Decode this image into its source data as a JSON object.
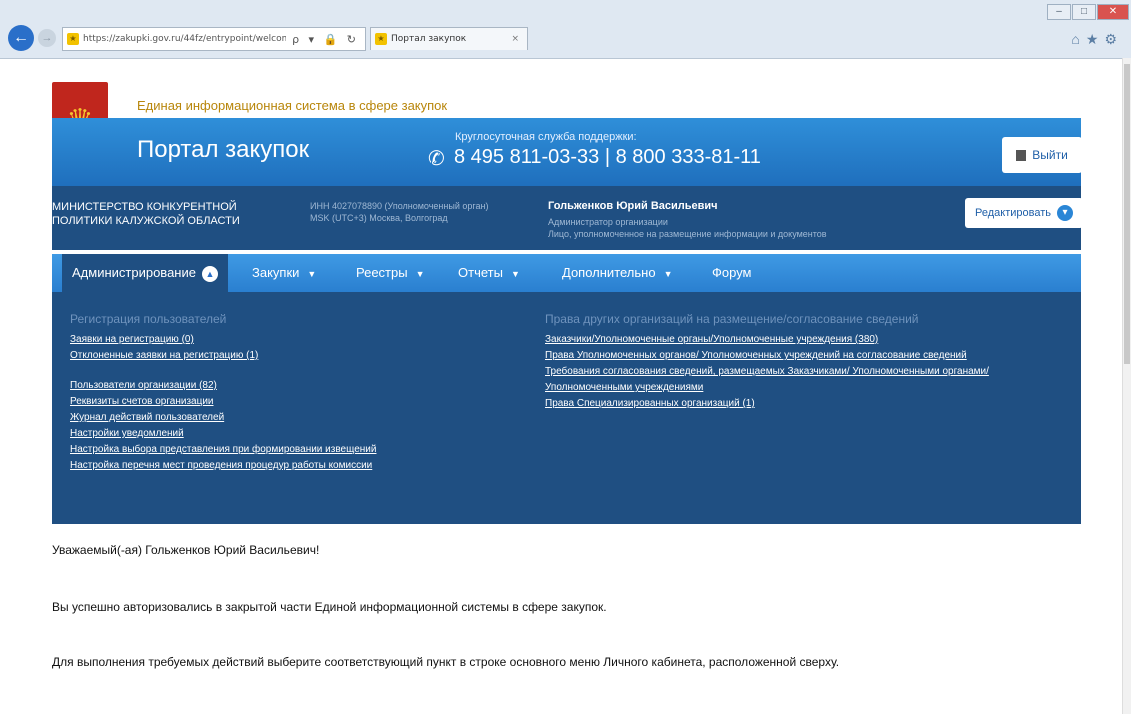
{
  "browser": {
    "url": "https://zakupki.gov.ru/44fz/entrypoint/welcome.html",
    "tab_title": "Портал закупок",
    "address_controls": "ρ ▾ 🔒 ↻",
    "tab_close": "×"
  },
  "site": {
    "system_name": "Единая информационная система в сфере закупок",
    "portal_title": "Портал закупок",
    "support_label": "Круглосуточная служба поддержки:",
    "phones": "8 495 811-03-33  |  8 800 333-81-11",
    "logout_label": "Выйти"
  },
  "org": {
    "name": "МИНИСТЕРСТВО КОНКУРЕНТНОЙ ПОЛИТИКИ КАЛУЖСКОЙ ОБЛАСТИ",
    "inn": "ИНН 4027078890 (Уполномоченный орган)",
    "timezone": "MSK (UTC+3) Москва, Волгоград",
    "user_name": "Гольженков Юрий Васильевич",
    "user_role": "Администратор организации",
    "user_role2": "Лицо, уполномоченное на размещение информации и документов",
    "edit_label": "Редактировать"
  },
  "nav": {
    "items": [
      {
        "label": "Администрирование"
      },
      {
        "label": "Закупки"
      },
      {
        "label": "Реестры"
      },
      {
        "label": "Отчеты"
      },
      {
        "label": "Дополнительно"
      },
      {
        "label": "Форум"
      }
    ]
  },
  "dropdown": {
    "left": {
      "heading": "Регистрация пользователей",
      "links": [
        "Заявки на регистрацию (0)",
        "Отклоненные заявки на регистрацию (1)",
        "Пользователи организации (82)",
        "Реквизиты счетов организации",
        "Журнал действий пользователей",
        "Настройки уведомлений",
        "Настройка выбора представления при формировании извещений",
        "Настройка перечня мест проведения процедур работы комиссии"
      ]
    },
    "right": {
      "heading": "Права других организаций на размещение/согласование сведений",
      "links": [
        "Заказчики/Уполномоченные органы/Уполномоченные учреждения (380)",
        "Права Уполномоченных органов/ Уполномоченных учреждений на согласование сведений",
        "Требования согласования сведений, размещаемых Заказчиками/ Уполномоченными органами/",
        "Уполномоченными учреждениями",
        "Права Специализированных организаций (1)"
      ]
    }
  },
  "messages": {
    "greeting": "Уважаемый(-ая) Гольженков Юрий Васильевич!",
    "success": "Вы успешно авторизовались в закрытой части Единой информационной системы в сфере закупок.",
    "instruction": "Для выполнения требуемых действий выберите соответствующий пункт в строке основного меню Личного кабинета, расположенной сверху."
  },
  "colors": {
    "header_blue": "#2a7fd0",
    "dark_blue": "#1f4f82",
    "gold": "#b8860b"
  }
}
